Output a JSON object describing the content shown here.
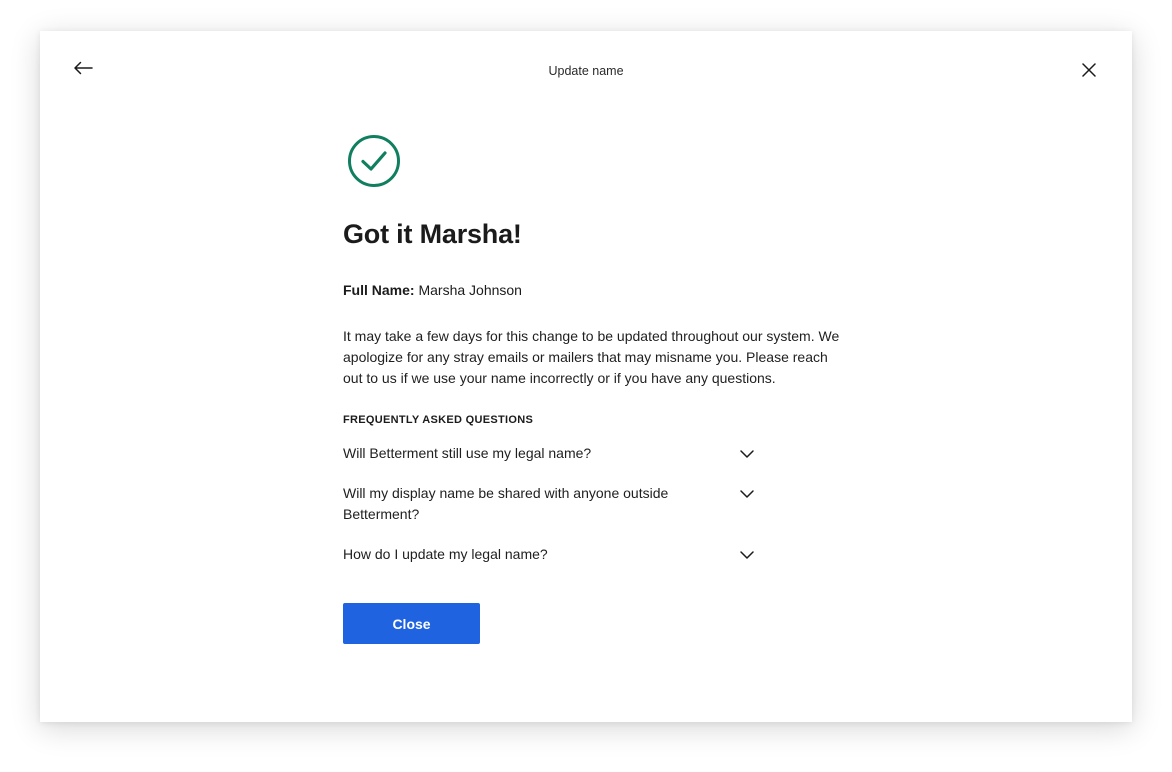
{
  "modal": {
    "title": "Update name"
  },
  "icons": {
    "back": "arrow-left-icon",
    "close": "close-icon",
    "success": "check-circle-icon",
    "expand": "chevron-down-icon"
  },
  "colors": {
    "success_green": "#0f7f5f",
    "primary_button": "#1f63e0"
  },
  "content": {
    "heading": "Got it Marsha!",
    "fullname_label": "Full Name:",
    "fullname_value": "Marsha Johnson",
    "description": "It may take a few days for this change to be updated throughout our system. We apologize for any stray emails or mailers that may misname you. Please reach out to us if we use your name incorrectly or if you have any questions.",
    "faq_title": "FREQUENTLY ASKED QUESTIONS",
    "faq": [
      {
        "question": "Will Betterment still use my legal name?"
      },
      {
        "question": "Will my display name be shared with anyone outside Betterment?"
      },
      {
        "question": "How do I update my legal name?"
      }
    ],
    "close_label": "Close"
  }
}
